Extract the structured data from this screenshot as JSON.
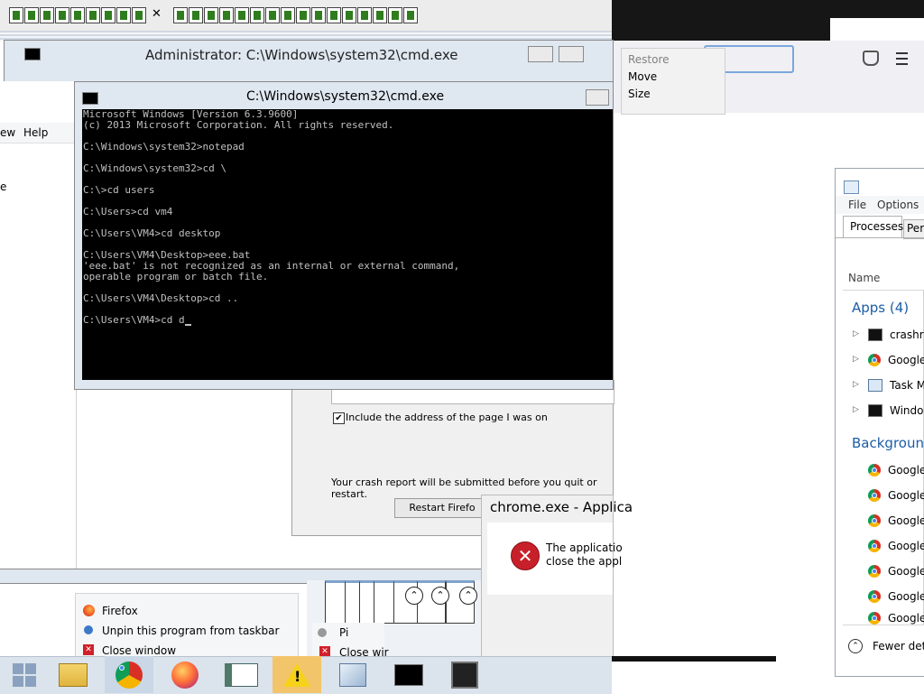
{
  "browser_tabs": {
    "close_symbol": "✕",
    "count_left": 9,
    "count_right": 16
  },
  "back_cmd_title": "Administrator: C:\\Windows\\system32\\cmd.exe",
  "cmd": {
    "title": "C:\\Windows\\system32\\cmd.exe",
    "lines": [
      "Microsoft Windows [Version 6.3.9600]",
      "(c) 2013 Microsoft Corporation. All rights reserved.",
      "",
      "C:\\Windows\\system32>notepad",
      "",
      "C:\\Windows\\system32>cd \\",
      "",
      "C:\\>cd users",
      "",
      "C:\\Users>cd vm4",
      "",
      "C:\\Users\\VM4>cd desktop",
      "",
      "C:\\Users\\VM4\\Desktop>eee.bat",
      "'eee.bat' is not recognized as an internal or external command,",
      "operable program or batch file.",
      "",
      "C:\\Users\\VM4\\Desktop>cd ..",
      ""
    ],
    "prompt": "C:\\Users\\VM4>cd d"
  },
  "left_menu": {
    "view_fragment": "ew",
    "help": "Help",
    "side_char": "e"
  },
  "system_menu": {
    "restore": "Restore",
    "move": "Move",
    "size": "Size"
  },
  "crash_reporter": {
    "include_address_label": "Include the address of the page I was on",
    "include_address_checked": true,
    "notice": "Your crash report will be submitted before you quit or restart.",
    "restart_button": "Restart Firefo"
  },
  "app_error": {
    "title": "chrome.exe - Applica",
    "message_line1": "The applicatio",
    "message_line2": "close the appl"
  },
  "jump_list": {
    "firefox": "Firefox",
    "unpin": "Unpin this program from taskbar",
    "close_window": "Close window"
  },
  "jump_list_2": {
    "pin_fragment": "Pi",
    "close_fragment": "Close wir"
  },
  "task_manager": {
    "menu": [
      "File",
      "Options"
    ],
    "tabs": [
      "Processes",
      "Perf"
    ],
    "column_name": "Name",
    "apps_header": "Apps (4)",
    "apps": [
      {
        "label": "crashrep",
        "icon": "crashreporter-icon"
      },
      {
        "label": "Google",
        "icon": "chrome-icon"
      },
      {
        "label": "Task Ma",
        "icon": "task-manager-icon"
      },
      {
        "label": "Window",
        "icon": "cmd-icon"
      }
    ],
    "background_header": "Background",
    "background": [
      "Google",
      "Google",
      "Google",
      "Google",
      "Google",
      "Google",
      "Google"
    ],
    "fewer_details": "Fewer deta"
  },
  "colors": {
    "console_bg": "#000000",
    "console_fg": "#c0c0c0",
    "tm_accent": "#1c5da8",
    "taskbar_bg": "#dbe3ec",
    "error_red": "#c8202a"
  }
}
